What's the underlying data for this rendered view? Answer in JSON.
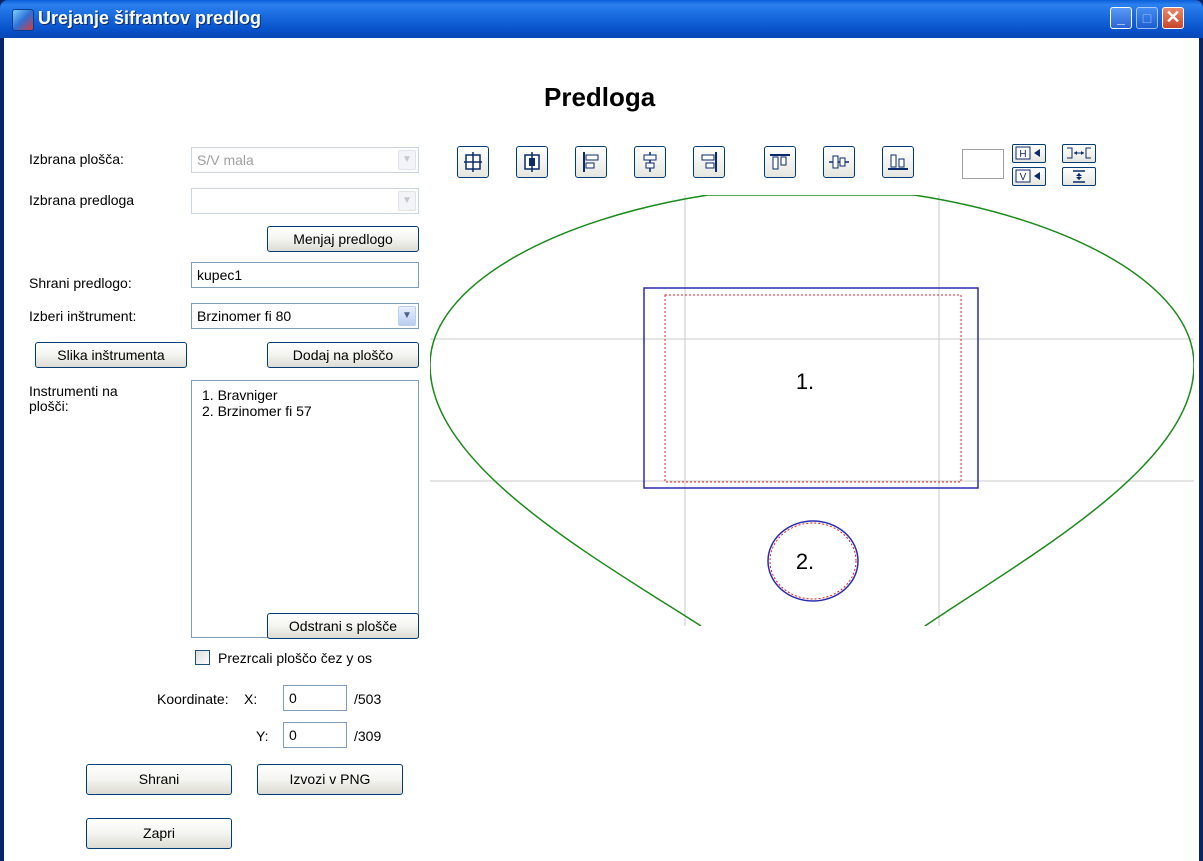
{
  "window": {
    "title": "Urejanje šifrantov predlog",
    "min_glyph": "_",
    "max_glyph": "□",
    "close_glyph": "✕"
  },
  "heading": "Predloga",
  "form": {
    "izbrana_plosca_label": "Izbrana plošča:",
    "izbrana_plosca_value": "S/V mala",
    "izbrana_predloga_label": "Izbrana predloga",
    "izbrana_predloga_value": "",
    "menjaj_button": "Menjaj predlogo",
    "shrani_predlogo_label": "Shrani predlogo:",
    "shrani_predlogo_value": "kupec1",
    "izberi_instrument_label": "Izberi inštrument:",
    "izberi_instrument_value": "Brzinomer fi 80",
    "slika_button": "Slika inštrumenta",
    "dodaj_button": "Dodaj na ploščo",
    "instrumenti_label_1": "Instrumenti na",
    "instrumenti_label_2": "plošči:",
    "instrumenti": [
      "1. Bravniger",
      "2. Brzinomer fi 57"
    ],
    "odstrani_button": "Odstrani s plošče",
    "prezrcali_label": "Prezrcali ploščo čez y os",
    "prezrcali_checked": false,
    "koordinate_label": "Koordinate:",
    "x_label": "X:",
    "x_value": "0",
    "x_max": "/503",
    "y_label": "Y:",
    "y_value": "0",
    "y_max": "/309",
    "shrani_button": "Shrani",
    "izvozi_button": "Izvozi v PNG",
    "zapri_button": "Zapri"
  },
  "toolbar": {
    "tools": [
      "center-horizontal-icon",
      "center-vertical-icon",
      "align-left-icon",
      "align-center-icon",
      "align-right-icon",
      "align-top-icon",
      "align-middle-icon",
      "align-bottom-icon"
    ],
    "small_tools": [
      "same-height-icon",
      "horizontal-spacing-icon",
      "same-width-icon",
      "vertical-spacing-icon"
    ],
    "small_glyphs": {
      "h": "H",
      "v": "V"
    }
  },
  "canvas": {
    "instrument_1_label": "1.",
    "instrument_2_label": "2.",
    "colors": {
      "panel_outline": "#1a8a1a",
      "instrument_box": "#2b2bb0",
      "inner_box": "#e02020",
      "grid": "#c8c8c8"
    }
  }
}
